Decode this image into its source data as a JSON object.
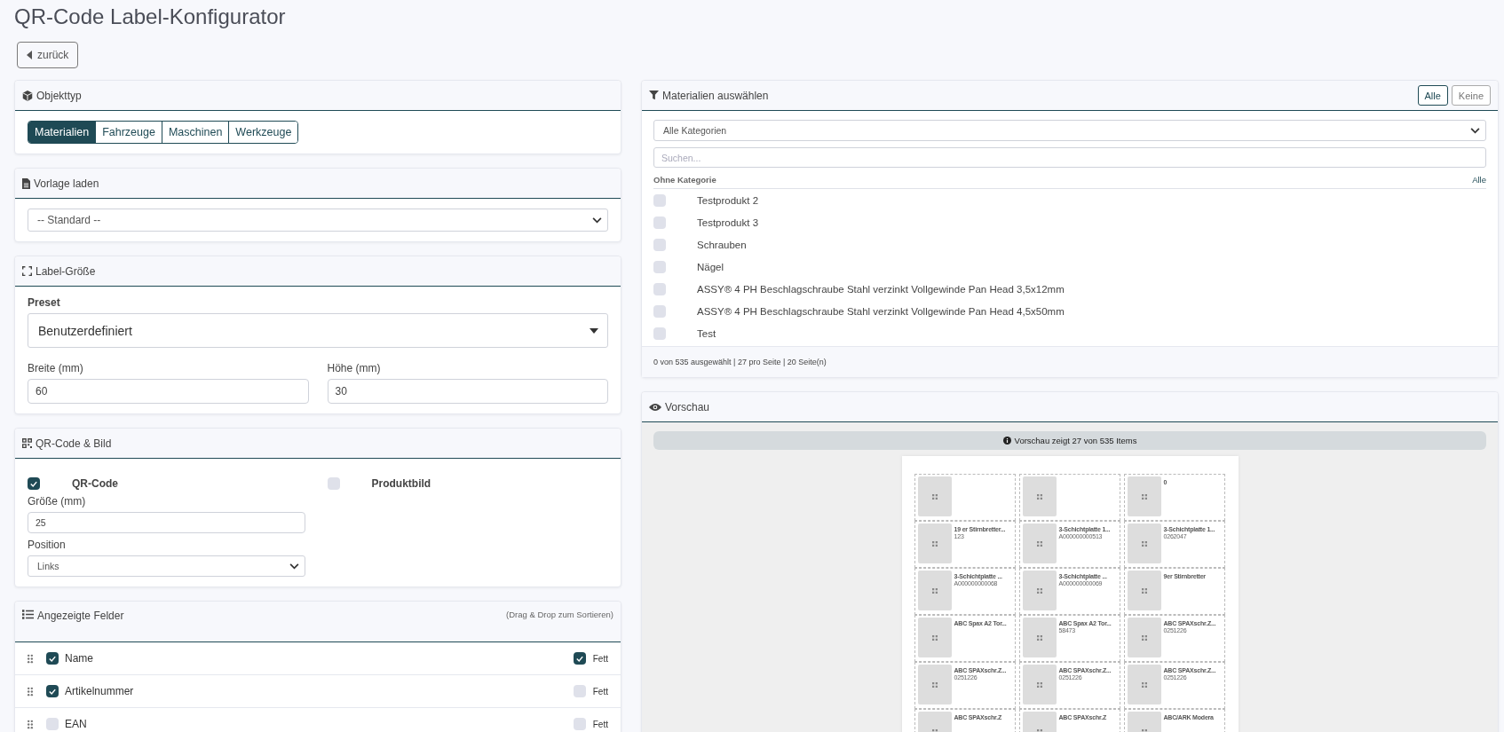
{
  "page": {
    "title": "QR-Code Label-Konfigurator",
    "back_button": "zurück"
  },
  "object_type": {
    "title": "Objekttyp",
    "tabs": [
      {
        "label": "Materialien",
        "selected": true
      },
      {
        "label": "Fahrzeuge",
        "selected": false
      },
      {
        "label": "Maschinen",
        "selected": false
      },
      {
        "label": "Werkzeuge",
        "selected": false
      }
    ]
  },
  "template": {
    "title": "Vorlage laden",
    "value": "-- Standard --"
  },
  "label_size": {
    "title": "Label-Größe",
    "preset_label": "Preset",
    "preset_value": "Benutzerdefiniert",
    "width_label": "Breite (mm)",
    "width_value": "60",
    "height_label": "Höhe (mm)",
    "height_value": "30"
  },
  "qr_image": {
    "title": "QR-Code & Bild",
    "options": [
      {
        "label": "QR-Code",
        "checked": true
      },
      {
        "label": "Produktbild",
        "checked": false
      }
    ],
    "size_label": "Größe (mm)",
    "size_value": "25",
    "position_label": "Position",
    "position_value": "Links"
  },
  "fields": {
    "title": "Angezeigte Felder",
    "hint": "(Drag & Drop zum Sortieren)",
    "rows": [
      {
        "name": "Name",
        "checked": true,
        "bold_label": "Fett",
        "bold": true
      },
      {
        "name": "Artikelnummer",
        "checked": true,
        "bold_label": "Fett",
        "bold": false
      },
      {
        "name": "EAN",
        "checked": false,
        "bold_label": "Fett",
        "bold": false
      }
    ]
  },
  "materials": {
    "title": "Materialien auswählen",
    "buttons": [
      {
        "label": "Alle",
        "kind": "primary"
      },
      {
        "label": "Keine",
        "kind": "secondary"
      }
    ],
    "category_value": "Alle Kategorien",
    "search_placeholder": "Suchen...",
    "group": "Ohne Kategorie",
    "group_all": "Alle",
    "items": [
      {
        "name": "Testprodukt 2",
        "checked": false
      },
      {
        "name": "Testprodukt 3",
        "checked": false
      },
      {
        "name": "Schrauben",
        "checked": false
      },
      {
        "name": "Nägel",
        "checked": false
      },
      {
        "name": "ASSY® 4 PH Beschlagschraube Stahl verzinkt Vollgewinde Pan Head 3,5x12mm",
        "checked": false
      },
      {
        "name": "ASSY® 4 PH Beschlagschraube Stahl verzinkt Vollgewinde Pan Head 4,5x50mm",
        "checked": false
      },
      {
        "name": "Test",
        "checked": false
      }
    ],
    "footer": "0 von 535 ausgewählt | 27 pro Seite | 20 Seite(n)"
  },
  "preview": {
    "title": "Vorschau",
    "info": "Vorschau zeigt 27 von 535 Items",
    "labels": [
      {
        "qr": true
      },
      {
        "qr": true
      },
      {
        "qr": true,
        "name": "0"
      },
      {
        "qr": true,
        "name": "19 er Stirnbretter...",
        "number": "123"
      },
      {
        "qr": true,
        "name": "3-Schichtplatte 1...",
        "number": "A000000000513"
      },
      {
        "qr": true,
        "name": "3-Schichtplatte 1...",
        "number": "0262047"
      },
      {
        "qr": true,
        "name": "3-Schichtplatte ...",
        "number": "A000000000068"
      },
      {
        "qr": true,
        "name": "3-Schichtplatte ...",
        "number": "A000000000069"
      },
      {
        "qr": true,
        "name": "9er Stirnbretter"
      },
      {
        "qr": true,
        "name": "ABC Spax A2 Tor..."
      },
      {
        "qr": true,
        "name": "ABC Spax A2 Tor...",
        "number": "58473"
      },
      {
        "qr": true,
        "name": "ABC SPAXschr.Z...",
        "number": "0251226"
      },
      {
        "qr": true,
        "name": "ABC SPAXschr.Z...",
        "number": "0251226"
      },
      {
        "qr": true,
        "name": "ABC SPAXschr.Z...",
        "number": "0251226"
      },
      {
        "qr": true,
        "name": "ABC SPAXschr.Z...",
        "number": "0251226"
      },
      {
        "qr": true,
        "name": "ABC SPAXschr.Z"
      },
      {
        "qr": true,
        "name": "ABC SPAXschr.Z"
      },
      {
        "qr": true,
        "name": "ABC/ARK Modera"
      }
    ]
  }
}
